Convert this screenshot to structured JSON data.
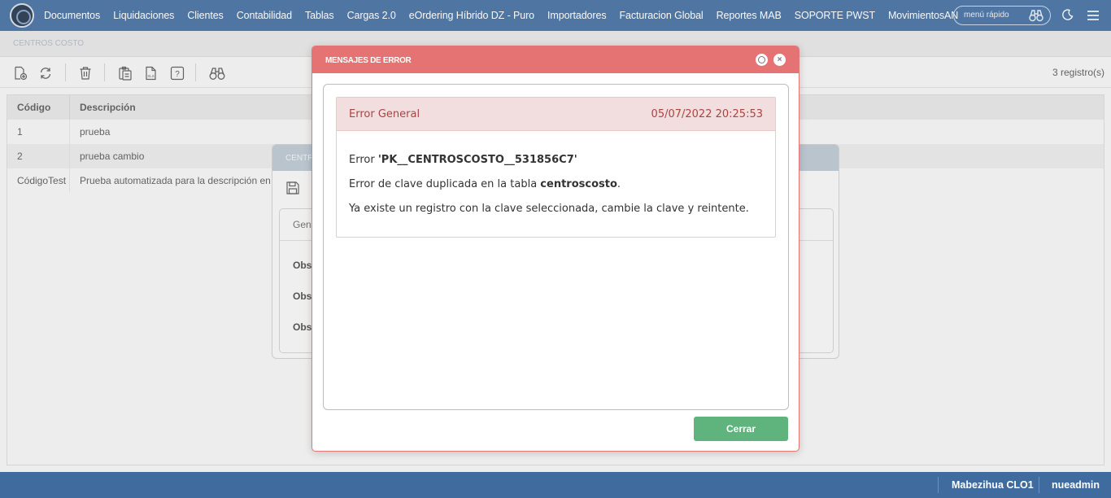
{
  "nav": {
    "items": [
      "Documentos",
      "Liquidaciones",
      "Clientes",
      "Contabilidad",
      "Tablas",
      "Cargas 2.0",
      "eOrdering Híbrido DZ - Puro",
      "Importadores",
      "Facturacion Global",
      "Reportes MAB",
      "SOPORTE PWST",
      "MovimientosAN"
    ],
    "quick_menu_label": "menú rápido"
  },
  "subheader": {
    "title": "CENTROS COSTO"
  },
  "toolbar": {
    "icons": [
      "new-document-icon",
      "refresh-icon",
      "trash-icon",
      "export-icon",
      "xls-icon",
      "help-icon",
      "binoculars-icon"
    ],
    "record_count": "3 registro(s)"
  },
  "grid": {
    "columns": [
      "Código",
      "Descripción"
    ],
    "rows": [
      {
        "code": "1",
        "desc": "prueba"
      },
      {
        "code": "2",
        "desc": "prueba cambio"
      },
      {
        "code": "CódigoTest",
        "desc": "Prueba automatizada para la descripción en ce"
      }
    ]
  },
  "bg_modal": {
    "title": "CENTR",
    "tab": "Gene",
    "fields": [
      "Obse",
      "Obse",
      "Obse"
    ]
  },
  "error_modal": {
    "title": "MENSAJES DE ERROR",
    "kind": "Error General",
    "timestamp": "05/07/2022 20:25:53",
    "line1_prefix": "Error ",
    "line1_key": "'PK__CENTROSCOSTO__531856C7'",
    "line2_prefix": "Error de clave duplicada en la tabla ",
    "line2_table": "centroscosto",
    "line2_suffix": ".",
    "line3": "Ya existe un registro con la clave seleccionada, cambie la clave y reintente.",
    "close_button": "Cerrar"
  },
  "footer": {
    "company": "Mabezihua CLO1",
    "user": "nueadmin"
  },
  "colors": {
    "nav": "#3f6b9f",
    "error_header": "#e57373",
    "error_text": "#a94442",
    "close_button": "#5fb47d"
  }
}
